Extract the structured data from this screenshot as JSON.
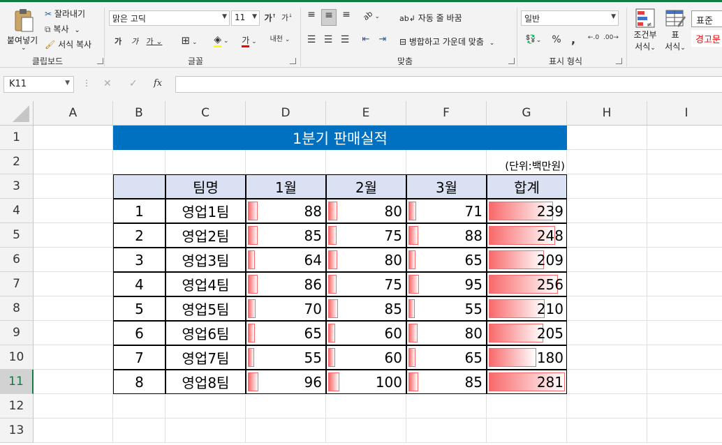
{
  "ribbon": {
    "clipboard": {
      "paste_label": "붙여넣기",
      "cut_label": "잘라내기",
      "copy_label": "복사",
      "format_painter_label": "서식 복사",
      "group_label": "클립보드"
    },
    "font": {
      "font_name": "맑은 고딕",
      "font_size": "11",
      "group_label": "글꼴"
    },
    "alignment": {
      "wrap_text_label": "자동 줄 바꿈",
      "merge_label": "병합하고 가운데 맞춤",
      "group_label": "맞춤"
    },
    "number": {
      "format": "일반",
      "group_label": "표시 형식"
    },
    "styles": {
      "conditional_label": "조건부",
      "conditional_label2": "서식",
      "table_label": "표",
      "table_label2": "서식",
      "normal_style": "표준",
      "warning_style": "경고문"
    }
  },
  "formula_bar": {
    "name_box": "K11",
    "fx_label": "fx",
    "formula": ""
  },
  "columns": [
    "A",
    "B",
    "C",
    "D",
    "E",
    "F",
    "G",
    "H",
    "I"
  ],
  "rows": [
    "1",
    "2",
    "3",
    "4",
    "5",
    "6",
    "7",
    "8",
    "9",
    "10",
    "11",
    "12",
    "13"
  ],
  "selected_row": "11",
  "sheet": {
    "title": "1분기 판매실적",
    "unit": "(단위:백만원)",
    "headers": [
      "",
      "팀명",
      "1월",
      "2월",
      "3월",
      "합계"
    ],
    "records": [
      {
        "no": "1",
        "team": "영업1팀",
        "m1": 88,
        "m2": 80,
        "m3": 71,
        "total": 239
      },
      {
        "no": "2",
        "team": "영업2팀",
        "m1": 85,
        "m2": 75,
        "m3": 88,
        "total": 248
      },
      {
        "no": "3",
        "team": "영업3팀",
        "m1": 64,
        "m2": 80,
        "m3": 65,
        "total": 209
      },
      {
        "no": "4",
        "team": "영업4팀",
        "m1": 86,
        "m2": 75,
        "m3": 95,
        "total": 256
      },
      {
        "no": "5",
        "team": "영업5팀",
        "m1": 70,
        "m2": 85,
        "m3": 55,
        "total": 210
      },
      {
        "no": "6",
        "team": "영업6팀",
        "m1": 65,
        "m2": 60,
        "m3": 80,
        "total": 205
      },
      {
        "no": "7",
        "team": "영업7팀",
        "m1": 55,
        "m2": 60,
        "m3": 65,
        "total": 180
      },
      {
        "no": "8",
        "team": "영업8팀",
        "m1": 96,
        "m2": 100,
        "m3": 85,
        "total": 281
      }
    ]
  },
  "colors": {
    "title_bg": "#0070c0",
    "header_bg": "#d9e1f2",
    "databar": "#f8696b",
    "accent": "#107c41"
  }
}
